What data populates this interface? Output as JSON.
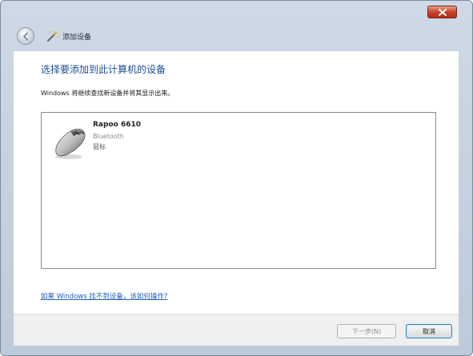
{
  "window": {
    "title": "添加设备",
    "close_icon": "close-icon",
    "accent_close": "#c9452d"
  },
  "nav": {
    "back_icon": "back-arrow-icon",
    "wizard_icon": "add-device-icon"
  },
  "main": {
    "heading": "选择要添加到此计算机的设备",
    "description": "Windows 将继续查找新设备并将其显示出来。",
    "devices": [
      {
        "name": "Rapoo 6610",
        "type": "Bluetooth",
        "category": "鼠标",
        "icon": "mouse-icon"
      }
    ],
    "help_link": "如果 Windows 找不到设备，该如何操作?"
  },
  "footer": {
    "next_label": "下一步(N)",
    "cancel_label": "取消"
  },
  "colors": {
    "heading": "#1e4e9b",
    "link": "#1e5fb8",
    "frame": "#bccada"
  }
}
